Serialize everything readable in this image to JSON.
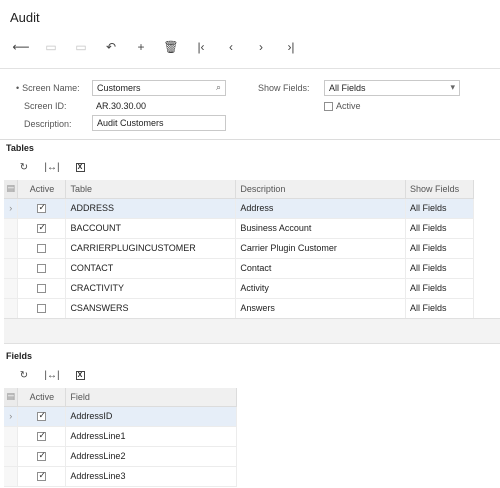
{
  "page": {
    "title": "Audit"
  },
  "toolbar": {
    "buttons": [
      {
        "name": "back-button",
        "icon": "arrow-left-icon",
        "glyph": "⟵",
        "disabled": false
      },
      {
        "name": "save-button",
        "icon": "save-icon",
        "glyph": "▭",
        "disabled": true
      },
      {
        "name": "save-close-button",
        "icon": "save-close-icon",
        "glyph": "▭",
        "disabled": true
      },
      {
        "name": "undo-button",
        "icon": "undo-icon",
        "glyph": "↶",
        "disabled": false
      },
      {
        "name": "add-button",
        "icon": "plus-icon",
        "glyph": "+",
        "disabled": false
      },
      {
        "name": "delete-button",
        "icon": "trash-icon",
        "glyph": "🗑",
        "disabled": false
      },
      {
        "name": "first-button",
        "icon": "first-record-icon",
        "glyph": "|‹",
        "disabled": false
      },
      {
        "name": "prev-button",
        "icon": "prev-record-icon",
        "glyph": "‹",
        "disabled": false
      },
      {
        "name": "next-button",
        "icon": "next-record-icon",
        "glyph": "›",
        "disabled": false
      },
      {
        "name": "last-button",
        "icon": "last-record-icon",
        "glyph": "›|",
        "disabled": false
      }
    ]
  },
  "form": {
    "screen_name_label": "Screen Name:",
    "screen_name_value": "Customers",
    "screen_id_label": "Screen ID:",
    "screen_id_value": "AR.30.30.00",
    "description_label": "Description:",
    "description_value": "Audit Customers",
    "show_fields_label": "Show Fields:",
    "show_fields_value": "All Fields",
    "active_label": "Active",
    "active_checked": false
  },
  "tables_section": {
    "title": "Tables",
    "columns": {
      "active": "Active",
      "table": "Table",
      "description": "Description",
      "show_fields": "Show Fields"
    },
    "rows": [
      {
        "active": true,
        "table": "ADDRESS",
        "description": "Address",
        "show_fields": "All Fields",
        "selected": true
      },
      {
        "active": true,
        "table": "BACCOUNT",
        "description": "Business Account",
        "show_fields": "All Fields",
        "selected": false
      },
      {
        "active": false,
        "table": "CARRIERPLUGINCUSTOMER",
        "description": "Carrier Plugin Customer",
        "show_fields": "All Fields",
        "selected": false
      },
      {
        "active": false,
        "table": "CONTACT",
        "description": "Contact",
        "show_fields": "All Fields",
        "selected": false
      },
      {
        "active": false,
        "table": "CRACTIVITY",
        "description": "Activity",
        "show_fields": "All Fields",
        "selected": false
      },
      {
        "active": false,
        "table": "CSANSWERS",
        "description": "Answers",
        "show_fields": "All Fields",
        "selected": false
      }
    ]
  },
  "fields_section": {
    "title": "Fields",
    "columns": {
      "active": "Active",
      "field": "Field"
    },
    "rows": [
      {
        "active": true,
        "field": "AddressID",
        "selected": true
      },
      {
        "active": true,
        "field": "AddressLine1",
        "selected": false
      },
      {
        "active": true,
        "field": "AddressLine2",
        "selected": false
      },
      {
        "active": true,
        "field": "AddressLine3",
        "selected": false
      }
    ]
  },
  "glyphs": {
    "refresh": "↻",
    "fit": "|↔|",
    "excel": "X",
    "row_arrow": "›",
    "search": "⌕",
    "dropdown": "▾",
    "settings": "▤"
  }
}
